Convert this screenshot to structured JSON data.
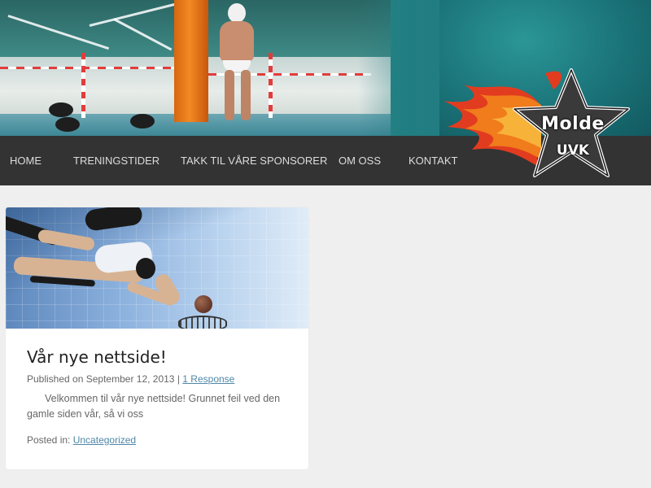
{
  "brand": {
    "logo_title": "Molde",
    "logo_subtitle": "UVK",
    "colors": {
      "nav_bg": "#333333",
      "flame_orange": "#f07c1c",
      "flame_red": "#e23c20",
      "star_dark": "#3a3a3a"
    }
  },
  "nav": {
    "items": [
      {
        "label": "HOME"
      },
      {
        "label": "TRENINGSTIDER"
      },
      {
        "label": "TAKK TIL VÅRE SPONSORER"
      },
      {
        "label": "OM OSS"
      },
      {
        "label": "KONTAKT"
      }
    ]
  },
  "post": {
    "title": "Vår nye nettside!",
    "published_prefix": "Published on",
    "date": "September 12, 2013",
    "separator": "|",
    "responses": "1 Response",
    "excerpt": "Velkommen til vår nye nettside!  Grunnet feil ved den gamle siden vår, så vi oss",
    "posted_in_label": "Posted in:",
    "category": "Uncategorized"
  }
}
